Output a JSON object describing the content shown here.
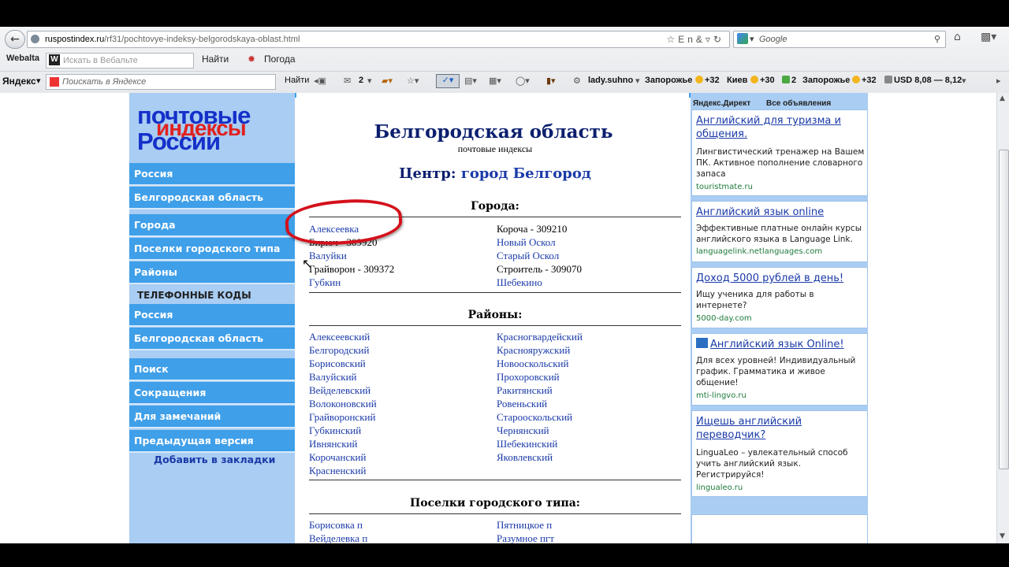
{
  "browser": {
    "url_site": "ruspostindex.ru",
    "url_path": "/rf31/pochtovye-indeksy-belgorodskaya-oblast.html",
    "search_placeholder": "Google",
    "webalta_logo": "Webalta",
    "webalta_placeholder": "Искать в Вебальте",
    "webalta_find": "Найти",
    "weather": "Погода",
    "yandex_logo": "Яндекс",
    "yandex_placeholder": "Поискать в Яндексе",
    "yandex_find": "Найти",
    "count_mail": "2",
    "user": "lady.suhno",
    "city1": "Запорожье",
    "temp1": "+32",
    "city2": "Киев",
    "temp2": "+30",
    "count2": "2",
    "city3": "Запорожье",
    "temp3": "+32",
    "currency": "USD 8,08 — 8,12"
  },
  "sidebar": {
    "logo_line1": "почтовые",
    "logo_line2": "индексы",
    "logo_line3": "России",
    "items": [
      {
        "label": "Россия"
      },
      {
        "label": "Белгородская область"
      },
      {
        "label": "Города"
      },
      {
        "label": "Поселки городского типа"
      },
      {
        "label": "Районы"
      }
    ],
    "phone_heading": "ТЕЛЕФОННЫЕ КОДЫ",
    "phone_items": [
      {
        "label": "Россия"
      },
      {
        "label": "Белгородская область"
      }
    ],
    "extra_items": [
      {
        "label": "Поиск"
      },
      {
        "label": "Сокращения"
      },
      {
        "label": "Для замечаний"
      },
      {
        "label": "Предыдущая версия"
      }
    ],
    "bookmark": "Добавить в закладки"
  },
  "main": {
    "title": "Белгородская область",
    "subtitle": "почтовые индексы",
    "center_label": "Центр:",
    "center_city": "город Белгород",
    "cities_heading": "Города:",
    "cities_left": [
      {
        "text": "Алексеевка",
        "link": true
      },
      {
        "text": "Бирюч - 309920",
        "link": false
      },
      {
        "text": "Валуйки",
        "link": true
      },
      {
        "text": "Грайворон - 309372",
        "link": false
      },
      {
        "text": "Губкин",
        "link": true
      }
    ],
    "cities_right": [
      {
        "text": "Короча - 309210",
        "link": false
      },
      {
        "text": "Новый Оскол",
        "link": true
      },
      {
        "text": "Старый Оскол",
        "link": true
      },
      {
        "text": "Строитель - 309070",
        "link": false
      },
      {
        "text": "Шебекино",
        "link": true
      }
    ],
    "districts_heading": "Районы:",
    "districts_left": [
      "Алексеевский",
      "Белгородский",
      "Борисовский",
      "Валуйский",
      "Вейделевский",
      "Волоконовский",
      "Грайворонский",
      "Губкинский",
      "Ивнянский",
      "Корочанский",
      "Красненский"
    ],
    "districts_right": [
      "Красногвардейский",
      "Краснояружский",
      "Новооскольский",
      "Прохоровский",
      "Ракитянский",
      "Ровеньский",
      "Старооскольский",
      "Чернянский",
      "Шебекинский",
      "Яковлевский"
    ],
    "towns_heading": "Поселки городского типа:",
    "towns_left": [
      "Борисовка п",
      "Вейделевка п"
    ],
    "towns_right": [
      "Пятницкое п",
      "Разумное пгт"
    ]
  },
  "ads": {
    "tab1": "Яндекс.Директ",
    "tab2": "Все объявления",
    "items": [
      {
        "title": "Английский для туризма и общения.",
        "text": "Лингвистический тренажер на Вашем ПК. Активное пополнение словарного запаса",
        "url": "touristmate.ru"
      },
      {
        "title": "Английский язык online",
        "text": "Эффективные платные онлайн курсы английского языка в Language Link.",
        "url": "languagelink.netlanguages.com"
      },
      {
        "title": "Доход 5000 рублей в день!",
        "text": "Ищу ученика для работы в интернете?",
        "url": "5000-day.com"
      },
      {
        "title": "Английский язык Online!",
        "text": "Для всех уровней! Индивидуальный график. Грамматика и живое общение!",
        "url": "mti-lingvo.ru"
      },
      {
        "title": "Ищешь английский переводчик?",
        "text": "LinguaLeo – увлекательный способ учить английский язык. Регистрируйся!",
        "url": "lingualeo.ru"
      }
    ]
  }
}
